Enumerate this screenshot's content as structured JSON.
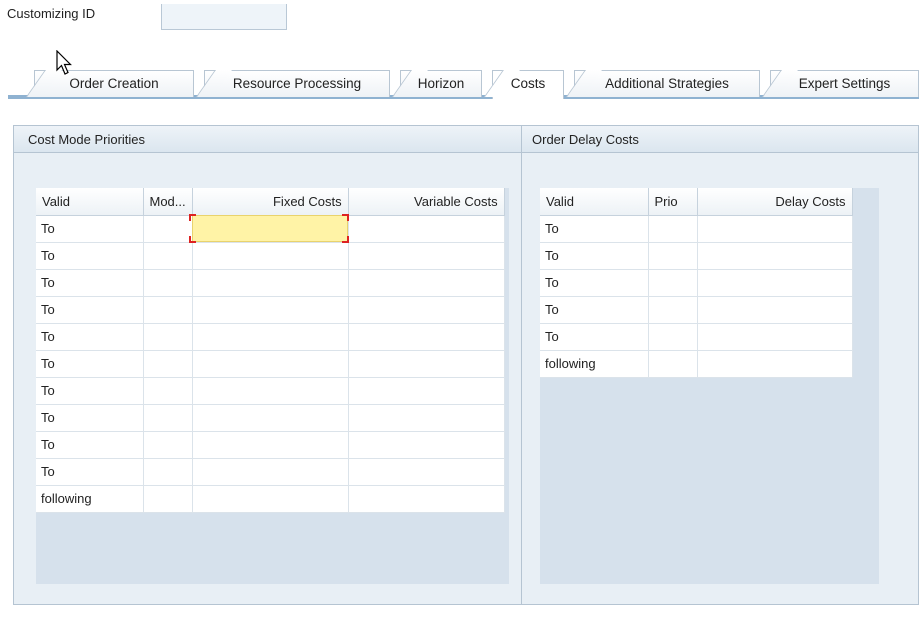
{
  "header": {
    "customizing_id_label": "Customizing ID",
    "customizing_id_value": ""
  },
  "tabs": [
    {
      "label": "Order Creation",
      "active": false
    },
    {
      "label": "Resource Processing",
      "active": false
    },
    {
      "label": "Horizon",
      "active": false
    },
    {
      "label": "Costs",
      "active": true
    },
    {
      "label": "Additional Strategies",
      "active": false
    },
    {
      "label": "Expert Settings",
      "active": false
    }
  ],
  "cost_mode_priorities": {
    "title": "Cost Mode Priorities",
    "columns": [
      "Valid",
      "Mod...",
      "Fixed Costs",
      "Variable Costs"
    ],
    "rows": [
      [
        "To",
        "",
        "",
        ""
      ],
      [
        "To",
        "",
        "",
        ""
      ],
      [
        "To",
        "",
        "",
        ""
      ],
      [
        "To",
        "",
        "",
        ""
      ],
      [
        "To",
        "",
        "",
        ""
      ],
      [
        "To",
        "",
        "",
        ""
      ],
      [
        "To",
        "",
        "",
        ""
      ],
      [
        "To",
        "",
        "",
        ""
      ],
      [
        "To",
        "",
        "",
        ""
      ],
      [
        "To",
        "",
        "",
        ""
      ],
      [
        "following",
        "",
        "",
        ""
      ]
    ]
  },
  "order_delay_costs": {
    "title": "Order Delay Costs",
    "columns": [
      "Valid",
      "Prio",
      "Delay Costs"
    ],
    "rows": [
      [
        "To",
        "",
        ""
      ],
      [
        "To",
        "",
        ""
      ],
      [
        "To",
        "",
        ""
      ],
      [
        "To",
        "",
        ""
      ],
      [
        "To",
        "",
        ""
      ],
      [
        "following",
        "",
        ""
      ]
    ]
  },
  "colors": {
    "selected_input": "#fff3a6",
    "selected_cell": "#ffc86a",
    "panel_bg": "#e8eff5"
  }
}
